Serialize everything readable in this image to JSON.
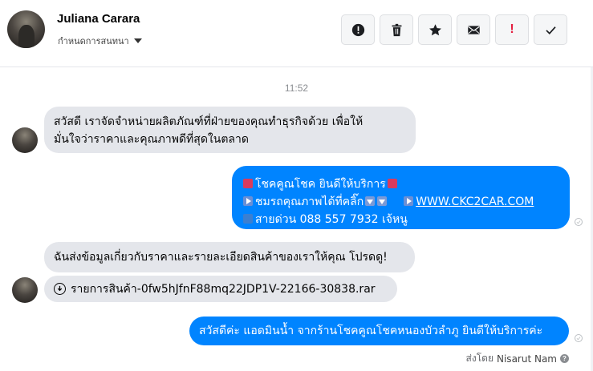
{
  "header": {
    "contact_name": "Juliana Carara",
    "subtitle": "กำหนดการสนทนา",
    "toolbar": [
      {
        "name": "report-button",
        "icon": "alert-circle-icon"
      },
      {
        "name": "delete-button",
        "icon": "trash-icon"
      },
      {
        "name": "star-button",
        "icon": "star-icon"
      },
      {
        "name": "mark-unread-button",
        "icon": "envelope-icon"
      },
      {
        "name": "important-button",
        "icon": "exclamation-icon",
        "label": "!"
      },
      {
        "name": "done-button",
        "icon": "check-icon"
      }
    ]
  },
  "conversation": {
    "timestamp": "11:52",
    "messages": [
      {
        "direction": "incoming",
        "line1": "สวัสดี เราจัดจำหน่ายผลิตภัณฑ์ที่ฝ่ายของคุณทำธุรกิจด้วย เพื่อให้",
        "line2": "มั่นใจว่าราคาและคุณภาพดีที่สุดในตลาด"
      },
      {
        "direction": "outgoing",
        "line1": "โชคคูณโชค ยินดีให้บริการ",
        "line2": "ชมรถคุณภาพได้ที่คลิ๊ก",
        "link": "WWW.CKC2CAR.COM",
        "line3": "สายด่วน 088 557 7932 เจ้หนู"
      },
      {
        "direction": "incoming",
        "text": "ฉันส่งข้อมูลเกี่ยวกับราคาและรายละเอียดสินค้าของเราให้คุณ โปรดดู!"
      },
      {
        "direction": "incoming",
        "attachment": "รายการสินค้า-0fw5hJfnF88mq22JDP1V-22166-30838.rar"
      },
      {
        "direction": "outgoing",
        "text": "สวัสดีค่ะ แอดมินน้ำ จากร้านโชคคูณโชคหนองบัวลำภู ยินดีให้บริการค่ะ"
      }
    ],
    "sent_by_label": "ส่งโดย",
    "sent_by_name": "Nisarut Nam"
  },
  "colors": {
    "outgoing_bubble": "#0084ff",
    "incoming_bubble": "#e4e6eb",
    "important_accent": "#e41e3f"
  }
}
